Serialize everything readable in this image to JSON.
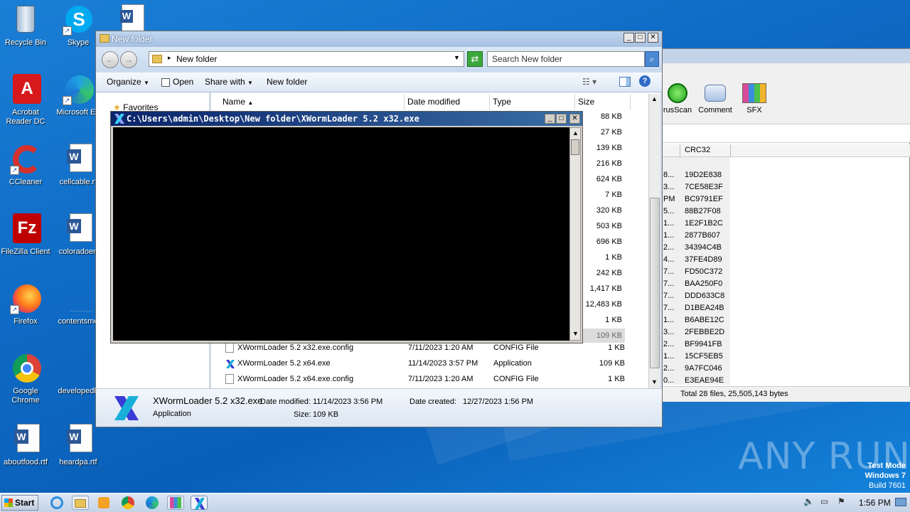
{
  "desktop": {
    "icons": [
      {
        "label": "Recycle Bin"
      },
      {
        "label": "Skype"
      },
      {
        "label": "Acrobat Reader DC"
      },
      {
        "label": "Microsoft Ed"
      },
      {
        "label": "CCleaner"
      },
      {
        "label": "cellcable.rt"
      },
      {
        "label": "FileZilla Client"
      },
      {
        "label": "coloradoen"
      },
      {
        "label": "Firefox"
      },
      {
        "label": "contentsme"
      },
      {
        "label": "Google Chrome"
      },
      {
        "label": "developedb"
      },
      {
        "label": "aboutfood.rtf"
      },
      {
        "label": "heardpa.rtf"
      }
    ],
    "watermark": {
      "brand": "ANY RUN",
      "line1": "Test Mode",
      "line2": "Windows 7",
      "line3": "Build 7601"
    }
  },
  "explorer": {
    "title": "New folder",
    "address": "New folder",
    "search_placeholder": "Search New folder",
    "toolbar": {
      "organize": "Organize",
      "open": "Open",
      "share_with": "Share with",
      "new_folder": "New folder"
    },
    "nav": {
      "favorites": "Favorites"
    },
    "columns": {
      "name": "Name",
      "date": "Date modified",
      "type": "Type",
      "size": "Size"
    },
    "sizes": [
      "88 KB",
      "27 KB",
      "139 KB",
      "216 KB",
      "624 KB",
      "7 KB",
      "320 KB",
      "503 KB",
      "696 KB",
      "1 KB",
      "242 KB",
      "1,417 KB",
      "12,483 KB",
      "1 KB",
      "109 KB"
    ],
    "files": [
      {
        "name": "XWormLoader 5.2 x32.exe.config",
        "date": "7/11/2023 1:20 AM",
        "type": "CONFIG File",
        "size": "1 KB"
      },
      {
        "name": "XWormLoader 5.2 x64.exe",
        "date": "11/14/2023 3:57 PM",
        "type": "Application",
        "size": "109 KB"
      },
      {
        "name": "XWormLoader 5.2 x64.exe.config",
        "date": "7/11/2023 1:20 AM",
        "type": "CONFIG File",
        "size": "1 KB"
      }
    ],
    "details": {
      "name": "XWormLoader 5.2 x32.exe",
      "type": "Application",
      "modified_label": "Date modified:",
      "modified": "11/14/2023 3:56 PM",
      "created_label": "Date created:",
      "created": "12/27/2023 1:56 PM",
      "size_label": "Size:",
      "size": "109 KB"
    }
  },
  "console": {
    "title": "C:\\Users\\admin\\Desktop\\New folder\\XWormLoader 5.2 x32.exe"
  },
  "winrar": {
    "toolbar": [
      {
        "label": "rusScan"
      },
      {
        "label": "Comment"
      },
      {
        "label": "SFX"
      }
    ],
    "crc_header": "CRC32",
    "rows": [
      {
        "p": "8...",
        "crc": "19D2E838"
      },
      {
        "p": "3...",
        "crc": "7CE58E3F"
      },
      {
        "p": "PM",
        "crc": "BC9791EF"
      },
      {
        "p": "5...",
        "crc": "88B27F08"
      },
      {
        "p": "1...",
        "crc": "1E2F1B2C"
      },
      {
        "p": "1...",
        "crc": "2877B607"
      },
      {
        "p": "2...",
        "crc": "34394C4B"
      },
      {
        "p": "4...",
        "crc": "37FE4D89"
      },
      {
        "p": "7...",
        "crc": "FD50C372"
      },
      {
        "p": "7...",
        "crc": "BAA250F0"
      },
      {
        "p": "7...",
        "crc": "DDD633C8"
      },
      {
        "p": "7...",
        "crc": "D1BEA24B"
      },
      {
        "p": "1...",
        "crc": "B6ABE12C"
      },
      {
        "p": "3...",
        "crc": "2FEBBE2D"
      },
      {
        "p": "2...",
        "crc": "BF9941FB"
      },
      {
        "p": "1...",
        "crc": "15CF5EB5"
      },
      {
        "p": "2...",
        "crc": "9A7FC046"
      },
      {
        "p": "0...",
        "crc": "E3EAE94E"
      }
    ],
    "status": "Total 28 files, 25,505,143 bytes"
  },
  "taskbar": {
    "start": "Start",
    "clock": "1:56 PM"
  }
}
